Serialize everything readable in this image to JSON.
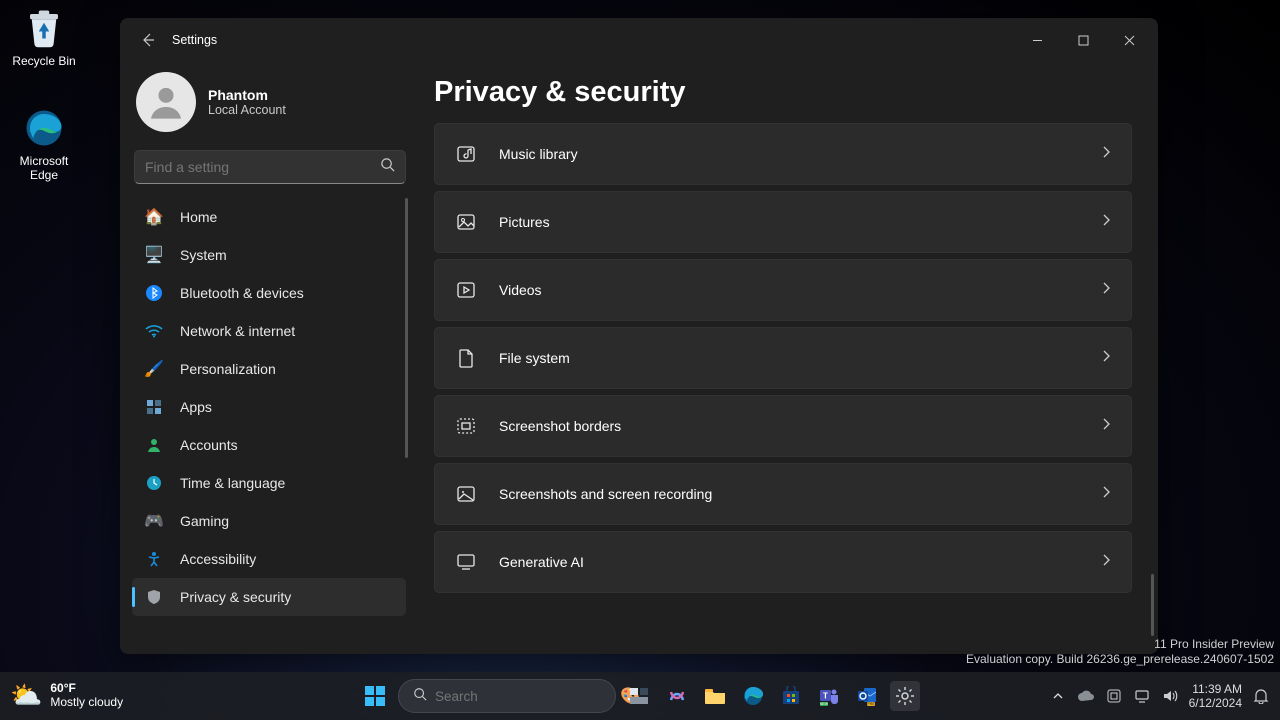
{
  "desktop": {
    "recycle_bin": "Recycle Bin",
    "edge": "Microsoft Edge"
  },
  "window": {
    "title": "Settings",
    "user_name": "Phantom",
    "user_sub": "Local Account",
    "search_placeholder": "Find a setting",
    "page_title": "Privacy & security",
    "nav": [
      {
        "label": "Home",
        "icon": "home"
      },
      {
        "label": "System",
        "icon": "system"
      },
      {
        "label": "Bluetooth & devices",
        "icon": "bluetooth"
      },
      {
        "label": "Network & internet",
        "icon": "wifi"
      },
      {
        "label": "Personalization",
        "icon": "pen"
      },
      {
        "label": "Apps",
        "icon": "apps"
      },
      {
        "label": "Accounts",
        "icon": "account"
      },
      {
        "label": "Time & language",
        "icon": "time"
      },
      {
        "label": "Gaming",
        "icon": "gaming"
      },
      {
        "label": "Accessibility",
        "icon": "access"
      },
      {
        "label": "Privacy & security",
        "icon": "privacy"
      }
    ],
    "rows": [
      {
        "label": "Music library",
        "icon": "music"
      },
      {
        "label": "Pictures",
        "icon": "pictures"
      },
      {
        "label": "Videos",
        "icon": "videos"
      },
      {
        "label": "File system",
        "icon": "file"
      },
      {
        "label": "Screenshot borders",
        "icon": "screenshot"
      },
      {
        "label": "Screenshots and screen recording",
        "icon": "screenrec"
      },
      {
        "label": "Generative AI",
        "icon": "genai"
      }
    ]
  },
  "taskbar": {
    "temp": "60°F",
    "cond": "Mostly cloudy",
    "search_placeholder": "Search",
    "time": "11:39 AM",
    "date": "6/12/2024"
  },
  "watermark": {
    "line1": "11 Pro Insider Preview",
    "line2": "Evaluation copy. Build 26236.ge_prerelease.240607-1502"
  }
}
